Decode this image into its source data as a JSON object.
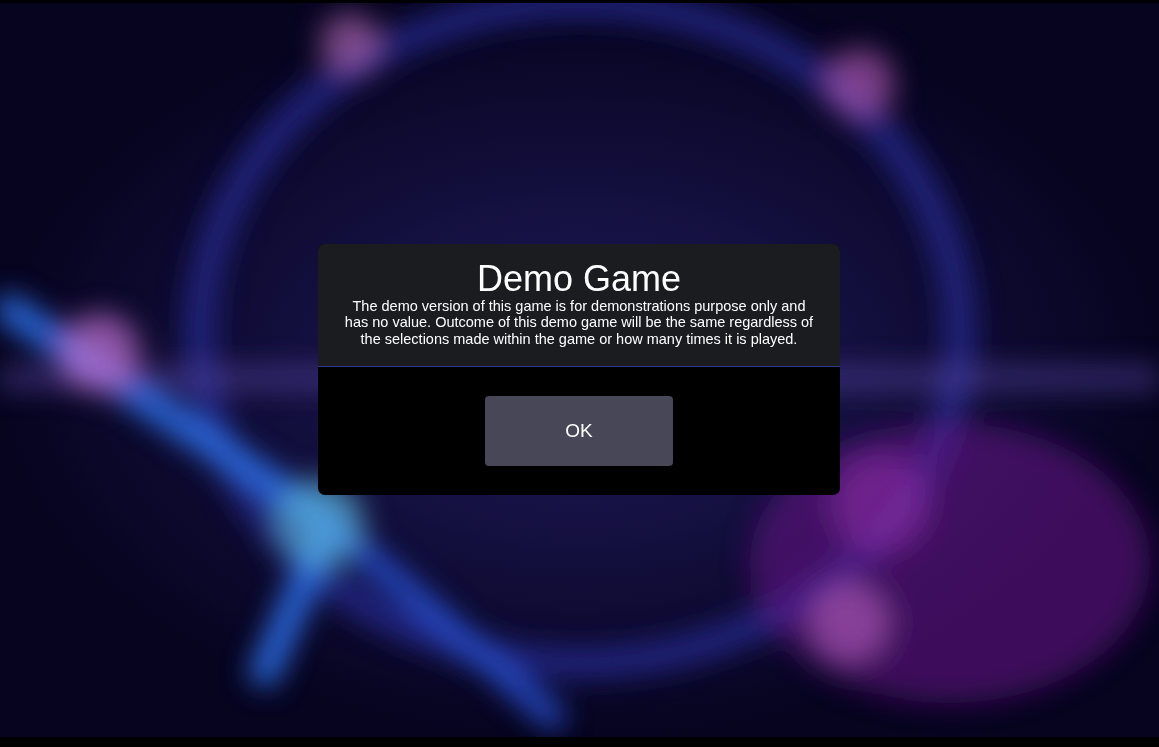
{
  "dialog": {
    "title": "Demo Game",
    "message": "The demo version of this game is for demonstrations purpose only and has no value. Outcome of this demo game will be the same regardless of the selections made within the game or how many times it is played.",
    "buttons": [
      "OK"
    ]
  }
}
